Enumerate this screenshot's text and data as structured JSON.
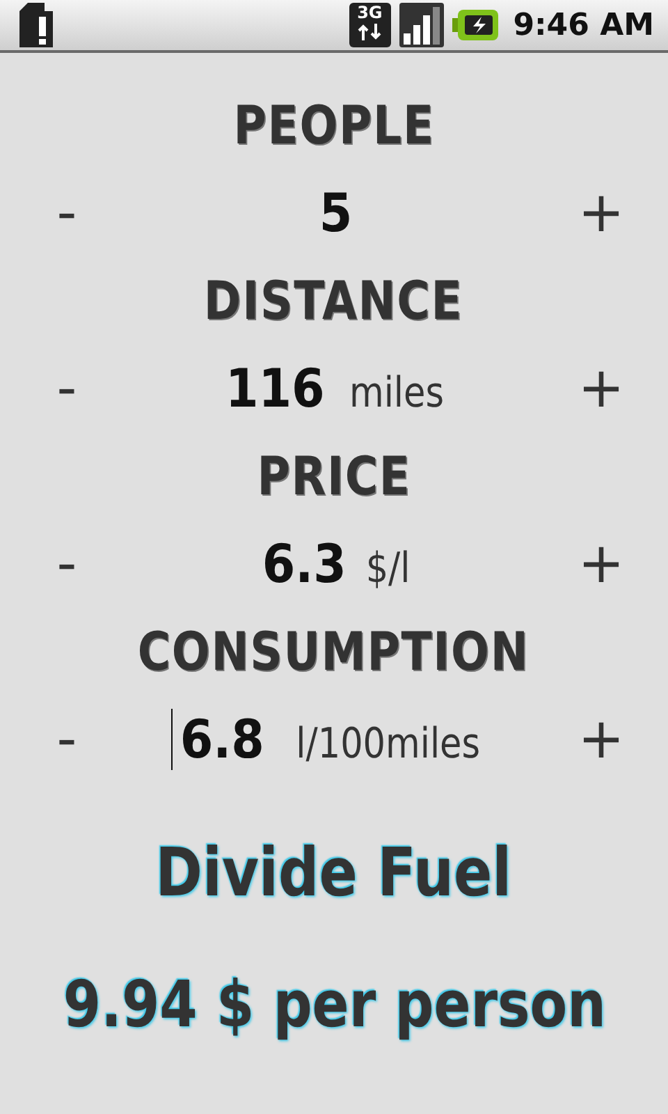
{
  "status_bar": {
    "network_type": "3G",
    "time": "9:46 AM"
  },
  "fields": [
    {
      "label": "PEOPLE",
      "value": "5",
      "focused": false
    },
    {
      "label": "DISTANCE",
      "value": "116",
      "unit": "miles",
      "focused": false
    },
    {
      "label": "PRICE",
      "value": "6.3",
      "unit": "$/l",
      "focused": false
    },
    {
      "label": "CONSUMPTION",
      "value": "6.8",
      "unit": "l/100miles",
      "focused": true
    }
  ],
  "decrement_label": "-",
  "increment_label": "+",
  "action": "Divide Fuel",
  "result": "9.94 $ per person"
}
